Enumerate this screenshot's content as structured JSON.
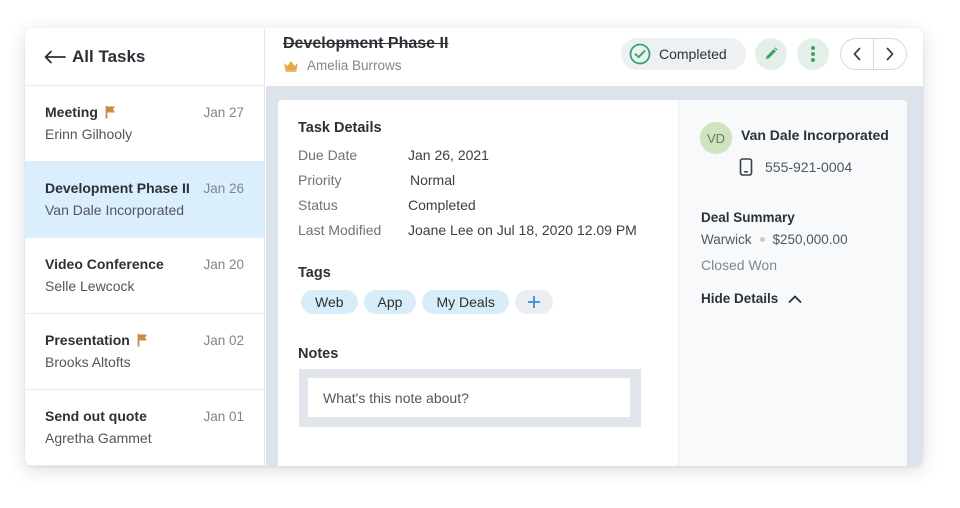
{
  "sidebar": {
    "title": "All Tasks",
    "tasks": [
      {
        "name": "Meeting",
        "sub": "Erinn Gilhooly",
        "date": "Jan 27",
        "flag": true
      },
      {
        "name": "Development Phase II",
        "sub": "Van Dale Incorporated",
        "date": "Jan 26",
        "flag": false,
        "active": true
      },
      {
        "name": "Video Conference",
        "sub": "Selle Lewcock",
        "date": "Jan 20",
        "flag": false
      },
      {
        "name": "Presentation",
        "sub": "Brooks Altofts",
        "date": "Jan 02",
        "flag": true
      },
      {
        "name": "Send out quote",
        "sub": "Agretha Gammet",
        "date": "Jan 01",
        "flag": false
      }
    ]
  },
  "header": {
    "title": "Development Phase II",
    "owner": "Amelia Burrows",
    "status": "Completed"
  },
  "details": {
    "title": "Task Details",
    "rows": [
      {
        "label": "Due Date",
        "value": "Jan 26, 2021"
      },
      {
        "label": "Priority",
        "value": "Normal"
      },
      {
        "label": "Status",
        "value": "Completed"
      },
      {
        "label": "Last Modified",
        "value": "Joane Lee on Jul 18, 2020 12.09 PM"
      }
    ]
  },
  "tags": {
    "title": "Tags",
    "items": [
      "Web",
      "App",
      "My Deals"
    ]
  },
  "notes": {
    "title": "Notes",
    "placeholder": "What's this note about?"
  },
  "contact": {
    "initials": "VD",
    "company": "Van Dale Incorporated",
    "phone": "555-921-0004"
  },
  "deal": {
    "title": "Deal Summary",
    "location": "Warwick",
    "amount": "$250,000.00",
    "stage": "Closed Won",
    "hide_label": "Hide Details"
  },
  "colors": {
    "accent_green": "#3aa366",
    "selected_row": "#dbeefb",
    "flag": "#c98a4a",
    "crown": "#e7a948",
    "tag_bg": "#d8ecfa",
    "add_plus": "#3d8fd6"
  },
  "icons": [
    "back-arrow-icon",
    "flag-icon",
    "crown-icon",
    "check-circle-icon",
    "pencil-icon",
    "more-vertical-icon",
    "chevron-left-icon",
    "chevron-right-icon",
    "plus-icon",
    "phone-icon",
    "chevron-up-icon"
  ]
}
